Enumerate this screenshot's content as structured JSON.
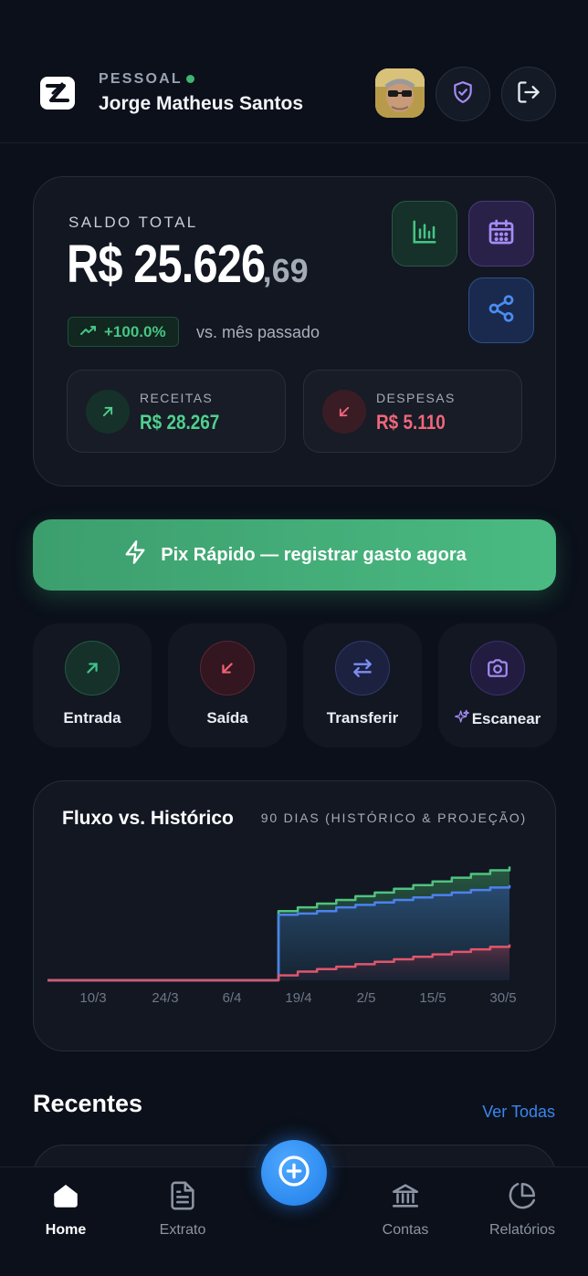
{
  "header": {
    "profile_type": "PESSOAL",
    "user_name": "Jorge Matheus Santos"
  },
  "balance": {
    "label": "SALDO TOTAL",
    "main": "R$ 25.626",
    "cents": ",69",
    "change": "+100.0%",
    "change_note": "vs. mês passado",
    "income_label": "RECEITAS",
    "income_value": "R$ 28.267",
    "expense_label": "DESPESAS",
    "expense_value": "R$ 5.110"
  },
  "pix": {
    "label": "Pix Rápido — registrar gasto agora"
  },
  "quick_actions": [
    {
      "label": "Entrada",
      "icon": "arrow-up-right-icon",
      "color": "#3fc38a"
    },
    {
      "label": "Saída",
      "icon": "arrow-down-left-icon",
      "color": "#ee5f73"
    },
    {
      "label": "Transferir",
      "icon": "transfer-icon",
      "color": "#7a8df5"
    },
    {
      "label": "Escanear",
      "icon": "camera-icon",
      "color": "#a58cf5"
    }
  ],
  "chart": {
    "title": "Fluxo vs. Histórico",
    "subtitle": "90 DIAS (HISTÓRICO & PROJEÇÃO)"
  },
  "chart_data": {
    "type": "area",
    "x_ticks": [
      "10/3",
      "24/3",
      "6/4",
      "19/4",
      "2/5",
      "15/5",
      "30/5"
    ],
    "series": [
      {
        "color": "#4fc27f",
        "values": [
          0,
          0,
          0,
          0,
          0,
          0,
          0,
          0,
          0,
          0,
          0,
          0,
          28000,
          29500,
          31000,
          32500,
          34000,
          35500,
          37000,
          38500,
          40000,
          41500,
          43000,
          44500,
          46000
        ]
      },
      {
        "color": "#4b82ee",
        "values": [
          0,
          0,
          0,
          0,
          0,
          0,
          0,
          0,
          0,
          0,
          0,
          0,
          26500,
          27000,
          28000,
          29500,
          30500,
          31500,
          32500,
          33500,
          34500,
          35500,
          36500,
          37500,
          38500
        ]
      },
      {
        "color": "#e0566c",
        "values": [
          0,
          0,
          0,
          0,
          0,
          0,
          0,
          0,
          0,
          0,
          0,
          0,
          2000,
          3500,
          4500,
          5500,
          6500,
          7500,
          8500,
          9500,
          10500,
          11500,
          12500,
          13500,
          14500
        ]
      }
    ],
    "ylim": [
      0,
      48000
    ]
  },
  "recent": {
    "title": "Recentes",
    "see_all": "Ver Todas"
  },
  "nav": {
    "items": [
      {
        "label": "Home",
        "icon": "home-icon",
        "active": true
      },
      {
        "label": "Extrato",
        "icon": "document-icon",
        "active": false
      },
      {
        "label": "Contas",
        "icon": "bank-icon",
        "active": false
      },
      {
        "label": "Relatórios",
        "icon": "pie-chart-icon",
        "active": false
      }
    ]
  },
  "colors": {
    "background": "#0b101a",
    "card": "#121722",
    "accent_green": "#4aba82",
    "income": "#4fd08c",
    "expense": "#f0677a",
    "link": "#3a86f0"
  }
}
